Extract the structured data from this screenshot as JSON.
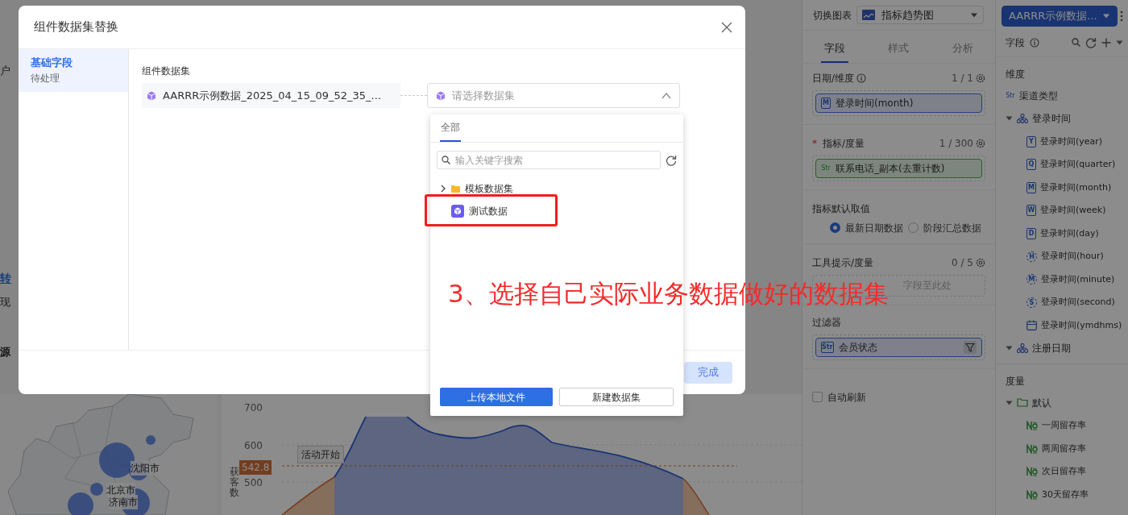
{
  "background": {
    "edge_texts": [
      {
        "text": "户",
        "kind": "plain"
      },
      {
        "text": "转",
        "kind": "link"
      },
      {
        "text": "现",
        "kind": "plain"
      },
      {
        "text": "源",
        "kind": "heading"
      }
    ],
    "map": {
      "city_labels": [
        "沈阳市",
        "北京市",
        "济南市"
      ]
    },
    "trend_chart": {
      "y_ticks": [
        "700",
        "600",
        "500"
      ],
      "y_axis_label": "获客数",
      "reference_label": "542.8",
      "annotation": "活动开始"
    }
  },
  "config_panel": {
    "switch_label": "切换图表",
    "chart_type": "指标趋势图",
    "tabs": [
      {
        "label": "字段",
        "selected": true
      },
      {
        "label": "样式",
        "selected": false
      },
      {
        "label": "分析",
        "selected": false
      }
    ],
    "date_dimension": {
      "title": "日期/维度",
      "count": "1 / 1",
      "field": {
        "badge": "M",
        "name": "登录时间(month)",
        "kind": "dimension"
      }
    },
    "measure": {
      "required_mark": "*",
      "title": "指标/度量",
      "count": "1 / 300",
      "field": {
        "badge": "Str",
        "name": "联系电话_副本(去重计数)",
        "kind": "measure"
      }
    },
    "default_value": {
      "title": "指标默认取值",
      "options": [
        {
          "label": "最新日期数据",
          "selected": true
        },
        {
          "label": "阶段汇总数据",
          "selected": false
        }
      ]
    },
    "tooltip_measure": {
      "title": "工具提示/度量",
      "count": "0 / 5",
      "placeholder": "字段至此处"
    },
    "filter": {
      "title": "过滤器",
      "field": {
        "badge": "Str",
        "name": "会员状态",
        "kind": "dimension"
      }
    },
    "auto_refresh": {
      "label": "自动刷新",
      "checked": false
    }
  },
  "field_panel": {
    "dataset_button": "AARRR示例数据...",
    "title": "字段",
    "sections": [
      {
        "title": "维度",
        "items": [
          {
            "name": "渠道类型",
            "kind": "string",
            "badge": "Str"
          },
          {
            "name": "登录时间",
            "kind": "hierarchy",
            "expanded": true,
            "children": [
              {
                "name": "登录时间(year)",
                "kind": "square",
                "badge": "Y"
              },
              {
                "name": "登录时间(quarter)",
                "kind": "square",
                "badge": "Q"
              },
              {
                "name": "登录时间(month)",
                "kind": "square",
                "badge": "M"
              },
              {
                "name": "登录时间(week)",
                "kind": "square",
                "badge": "W"
              },
              {
                "name": "登录时间(day)",
                "kind": "square",
                "badge": "D"
              },
              {
                "name": "登录时间(hour)",
                "kind": "circle",
                "badge": "H"
              },
              {
                "name": "登录时间(minute)",
                "kind": "circle",
                "badge": "M"
              },
              {
                "name": "登录时间(second)",
                "kind": "circle",
                "badge": "S"
              },
              {
                "name": "登录时间(ymdhms)",
                "kind": "calendar"
              }
            ]
          },
          {
            "name": "注册日期",
            "kind": "hierarchy",
            "expanded": true
          }
        ]
      },
      {
        "title": "度量",
        "items": [
          {
            "name": "默认",
            "kind": "folder",
            "expanded": true,
            "children": [
              {
                "name": "一周留存率",
                "kind": "number"
              },
              {
                "name": "两周留存率",
                "kind": "number"
              },
              {
                "name": "次日留存率",
                "kind": "number"
              },
              {
                "name": "30天留存率",
                "kind": "number"
              }
            ]
          }
        ]
      }
    ]
  },
  "modal": {
    "title": "组件数据集替换",
    "sidebar": [
      {
        "title": "基础字段",
        "status": "待处理",
        "selected": true
      }
    ],
    "dataset_label": "组件数据集",
    "source_dataset": "AARRR示例数据_2025_04_15_09_52_35_...",
    "target_select": {
      "placeholder": "请选择数据集",
      "expanded": true
    },
    "finish_button": {
      "label": "完成",
      "disabled": true
    }
  },
  "dropdown": {
    "tabs": [
      {
        "label": "全部",
        "selected": true
      }
    ],
    "search_placeholder": "输入关键字搜索",
    "tree": [
      {
        "name": "模板数据集",
        "kind": "folder",
        "expanded": false
      },
      {
        "name": "测试数据",
        "kind": "dataset"
      }
    ],
    "buttons": [
      {
        "label": "上传本地文件",
        "kind": "primary"
      },
      {
        "label": "新建数据集",
        "kind": "secondary"
      }
    ]
  },
  "annotation": {
    "text": "3、选择自己实际业务数据做好的数据集",
    "highlight": true
  }
}
